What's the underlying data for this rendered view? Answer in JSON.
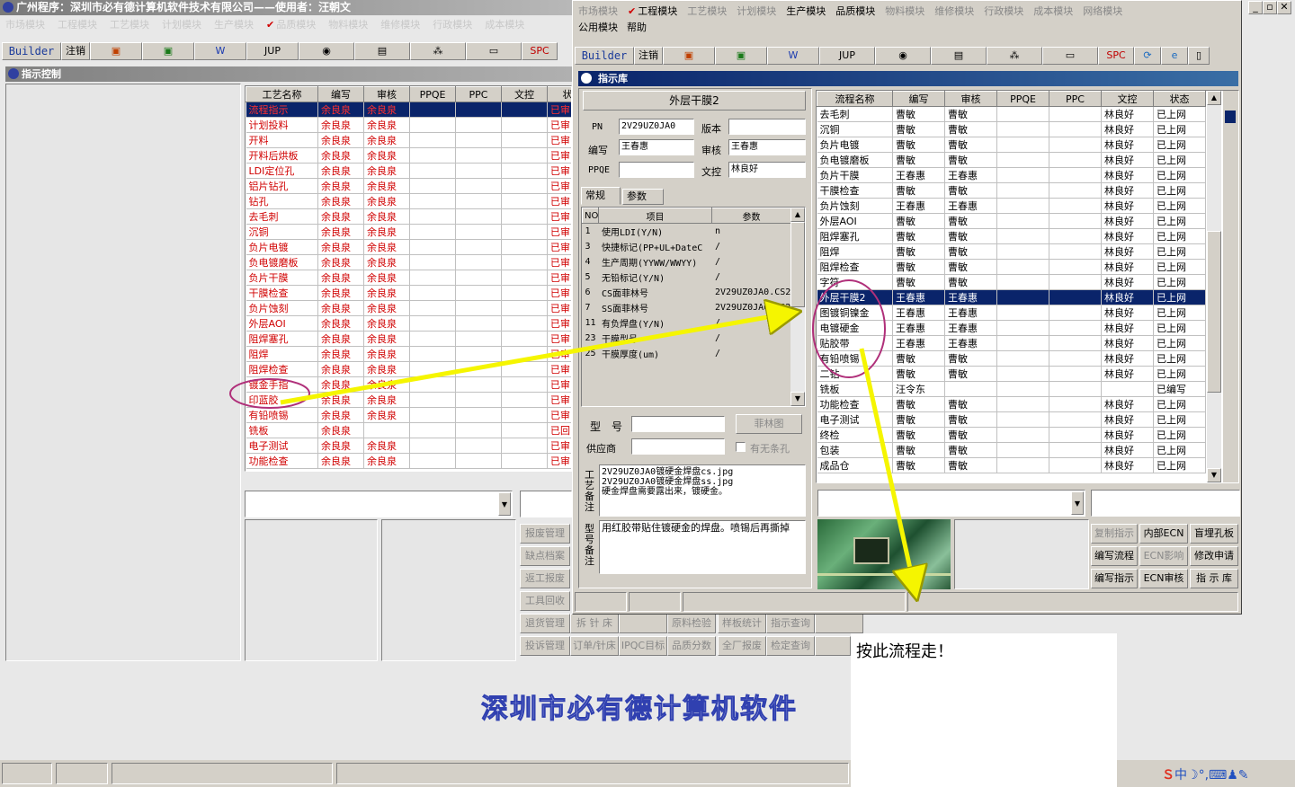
{
  "main_title": "广州程序：深圳市必有德计算机软件技术有限公司——使用者：汪朝文",
  "main_menu": [
    "市场模块",
    "工程模块",
    "工艺模块",
    "计划模块",
    "生产模块",
    "品质模块",
    "物料模块",
    "维修模块",
    "行政模块",
    "成本模块"
  ],
  "toolbar": {
    "builder": "Builder",
    "logout": "注销",
    "jup": "JUP",
    "spc": "SPC"
  },
  "left_panel_title": "指示控制",
  "left_table": {
    "headers": [
      "工艺名称",
      "编写",
      "审核",
      "PPQE",
      "PPC",
      "文控",
      "状"
    ],
    "rows": [
      [
        "流程指示",
        "余良泉",
        "余良泉",
        "",
        "",
        "",
        "已审"
      ],
      [
        "计划投料",
        "余良泉",
        "余良泉",
        "",
        "",
        "",
        "已审"
      ],
      [
        "开料",
        "余良泉",
        "余良泉",
        "",
        "",
        "",
        "已审"
      ],
      [
        "开料后烘板",
        "余良泉",
        "余良泉",
        "",
        "",
        "",
        "已审"
      ],
      [
        "LDI定位孔",
        "余良泉",
        "余良泉",
        "",
        "",
        "",
        "已审"
      ],
      [
        "铝片钻孔",
        "余良泉",
        "余良泉",
        "",
        "",
        "",
        "已审"
      ],
      [
        "钻孔",
        "余良泉",
        "余良泉",
        "",
        "",
        "",
        "已审"
      ],
      [
        "去毛刺",
        "余良泉",
        "余良泉",
        "",
        "",
        "",
        "已审"
      ],
      [
        "沉铜",
        "余良泉",
        "余良泉",
        "",
        "",
        "",
        "已审"
      ],
      [
        "负片电镀",
        "余良泉",
        "余良泉",
        "",
        "",
        "",
        "已审"
      ],
      [
        "负电镀磨板",
        "余良泉",
        "余良泉",
        "",
        "",
        "",
        "已审"
      ],
      [
        "负片干膜",
        "余良泉",
        "余良泉",
        "",
        "",
        "",
        "已审"
      ],
      [
        "干膜检查",
        "余良泉",
        "余良泉",
        "",
        "",
        "",
        "已审"
      ],
      [
        "负片蚀刻",
        "余良泉",
        "余良泉",
        "",
        "",
        "",
        "已审"
      ],
      [
        "外层AOI",
        "余良泉",
        "余良泉",
        "",
        "",
        "",
        "已审"
      ],
      [
        "阻焊塞孔",
        "余良泉",
        "余良泉",
        "",
        "",
        "",
        "已审"
      ],
      [
        "阻焊",
        "余良泉",
        "余良泉",
        "",
        "",
        "",
        "已审"
      ],
      [
        "阻焊检查",
        "余良泉",
        "余良泉",
        "",
        "",
        "",
        "已审"
      ],
      [
        "镀金手指",
        "余良泉",
        "余良泉",
        "",
        "",
        "",
        "已审"
      ],
      [
        "印蓝胶",
        "余良泉",
        "余良泉",
        "",
        "",
        "",
        "已审"
      ],
      [
        "有铅喷锡",
        "余良泉",
        "余良泉",
        "",
        "",
        "",
        "已审"
      ],
      [
        "铣板",
        "余良泉",
        "",
        "",
        "",
        "",
        "已回"
      ],
      [
        "电子测试",
        "余良泉",
        "余良泉",
        "",
        "",
        "",
        "已审"
      ],
      [
        "功能检查",
        "余良泉",
        "余良泉",
        "",
        "",
        "",
        "已审"
      ]
    ]
  },
  "left_buttons": [
    "报废管理",
    "缺点档案",
    "返工报废",
    "工具回收",
    "退货管理",
    "投诉管理"
  ],
  "bottom_buttons_r1": [
    "拆 针 床",
    "",
    "原料检验",
    "样板统计",
    "指示查询"
  ],
  "bottom_buttons_r2": [
    "订单/针床",
    "IPQC目标",
    "品质分数",
    "全厂报废",
    "检定查询"
  ],
  "watermark": "深圳市必有德计算机软件",
  "dialog": {
    "menu": [
      "市场模块",
      "工程模块",
      "工艺模块",
      "计划模块",
      "生产模块",
      "品质模块",
      "物料模块",
      "维修模块",
      "行政模块",
      "成本模块",
      "网络模块"
    ],
    "menu2": [
      "公用模块",
      "帮助"
    ],
    "title": "指示库",
    "form_title": "外层干膜2",
    "pn_label": "PN",
    "pn": "2V29UZ0JA0",
    "version_label": "版本",
    "version": "",
    "writer_label": "编写",
    "writer": "王春惠",
    "reviewer_label": "审核",
    "reviewer": "王春惠",
    "ppqe_label": "PPQE",
    "ppqe": "",
    "doc_label": "文控",
    "doc": "林良好",
    "tabs": [
      "常规",
      "参数"
    ],
    "param_headers": [
      "NO",
      "项目",
      "参数"
    ],
    "params": [
      [
        "1",
        "使用LDI(Y/N)",
        "n"
      ],
      [
        "3",
        "快捷标记(PP+UL+DateC",
        "/"
      ],
      [
        "4",
        "生产周期(YYWW/WWYY)",
        "/"
      ],
      [
        "5",
        "无铅标记(Y/N)",
        "/"
      ],
      [
        "6",
        "CS面菲林号",
        "2V29UZ0JA0.CS2"
      ],
      [
        "7",
        "SS面菲林号",
        "2V29UZ0JA0.SS2"
      ],
      [
        "11",
        "有负焊盘(Y/N)",
        "/"
      ],
      [
        "23",
        "干膜型号",
        "/"
      ],
      [
        "25",
        "干膜厚度(um)",
        "/"
      ]
    ],
    "model_label": "型　号",
    "filmbtn": "菲林图",
    "supplier_label": "供应商",
    "noline_label": "有无条孔",
    "remark1_label": "工艺备注",
    "remark1": "2V29UZ0JA0镀硬金焊盘cs.jpg\n2V29UZ0JA0镀硬金焊盘ss.jpg\n硬金焊盘需要露出来，镀硬金。",
    "remark2_label": "型号备注",
    "remark2": "用红胶带贴住镀硬金的焊盘。喷锡后再撕掉",
    "right_headers": [
      "流程名称",
      "编写",
      "审核",
      "PPQE",
      "PPC",
      "文控",
      "状态"
    ],
    "right_rows": [
      [
        "去毛刺",
        "曹敏",
        "曹敏",
        "",
        "",
        "林良好",
        "已上网"
      ],
      [
        "沉铜",
        "曹敏",
        "曹敏",
        "",
        "",
        "林良好",
        "已上网"
      ],
      [
        "负片电镀",
        "曹敏",
        "曹敏",
        "",
        "",
        "林良好",
        "已上网"
      ],
      [
        "负电镀磨板",
        "曹敏",
        "曹敏",
        "",
        "",
        "林良好",
        "已上网"
      ],
      [
        "负片干膜",
        "王春惠",
        "王春惠",
        "",
        "",
        "林良好",
        "已上网"
      ],
      [
        "干膜检查",
        "曹敏",
        "曹敏",
        "",
        "",
        "林良好",
        "已上网"
      ],
      [
        "负片蚀刻",
        "王春惠",
        "王春惠",
        "",
        "",
        "林良好",
        "已上网"
      ],
      [
        "外层AOI",
        "曹敏",
        "曹敏",
        "",
        "",
        "林良好",
        "已上网"
      ],
      [
        "阻焊塞孔",
        "曹敏",
        "曹敏",
        "",
        "",
        "林良好",
        "已上网"
      ],
      [
        "阻焊",
        "曹敏",
        "曹敏",
        "",
        "",
        "林良好",
        "已上网"
      ],
      [
        "阻焊检查",
        "曹敏",
        "曹敏",
        "",
        "",
        "林良好",
        "已上网"
      ],
      [
        "字符",
        "曹敏",
        "曹敏",
        "",
        "",
        "林良好",
        "已上网"
      ],
      [
        "外层干膜2",
        "王春惠",
        "王春惠",
        "",
        "",
        "林良好",
        "已上网"
      ],
      [
        "图镀铜镍金",
        "王春惠",
        "王春惠",
        "",
        "",
        "林良好",
        "已上网"
      ],
      [
        "电镀硬金",
        "王春惠",
        "王春惠",
        "",
        "",
        "林良好",
        "已上网"
      ],
      [
        "贴胶带",
        "王春惠",
        "王春惠",
        "",
        "",
        "林良好",
        "已上网"
      ],
      [
        "有铅喷锡",
        "曹敏",
        "曹敏",
        "",
        "",
        "林良好",
        "已上网"
      ],
      [
        "二钻",
        "曹敏",
        "曹敏",
        "",
        "",
        "林良好",
        "已上网"
      ],
      [
        "铣板",
        "汪令东",
        "",
        "",
        "",
        "",
        "已编写"
      ],
      [
        "功能检查",
        "曹敏",
        "曹敏",
        "",
        "",
        "林良好",
        "已上网"
      ],
      [
        "电子测试",
        "曹敏",
        "曹敏",
        "",
        "",
        "林良好",
        "已上网"
      ],
      [
        "终检",
        "曹敏",
        "曹敏",
        "",
        "",
        "林良好",
        "已上网"
      ],
      [
        "包装",
        "曹敏",
        "曹敏",
        "",
        "",
        "林良好",
        "已上网"
      ],
      [
        "成品仓",
        "曹敏",
        "曹敏",
        "",
        "",
        "林良好",
        "已上网"
      ]
    ],
    "action_buttons": [
      [
        "复制指示",
        "内部ECN",
        "盲埋孔板"
      ],
      [
        "编写流程",
        "ECN影响",
        "修改申请"
      ],
      [
        "编写指示",
        "ECN审核",
        "指 示 库"
      ]
    ]
  },
  "annotation": "按此流程走！",
  "colors": {
    "title_bar": "#0a246a",
    "highlight": "#0a246a",
    "red_text": "#d00000",
    "arrow": "#f5f500",
    "circle": "#b0307a"
  }
}
